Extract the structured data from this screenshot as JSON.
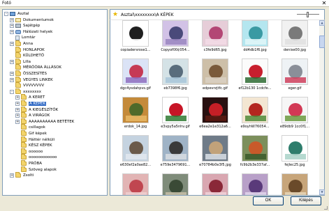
{
  "window": {
    "title": "Fotó"
  },
  "tree": [
    {
      "label": "Asztal",
      "indent": 0,
      "exp": "-",
      "icon": "desk",
      "selected": false
    },
    {
      "label": "Dokumentumok",
      "indent": 1,
      "exp": "+",
      "icon": "docs",
      "selected": false
    },
    {
      "label": "Sajátgép",
      "indent": 1,
      "exp": "+",
      "icon": "drive",
      "selected": false
    },
    {
      "label": "Hálózati helyek",
      "indent": 1,
      "exp": "+",
      "icon": "net",
      "selected": false
    },
    {
      "label": "Lomtár",
      "indent": 1,
      "exp": "",
      "icon": "bin",
      "selected": false
    },
    {
      "label": "Anna",
      "indent": 1,
      "exp": "+",
      "icon": "folder",
      "selected": false
    },
    {
      "label": "HONLAPOK",
      "indent": 1,
      "exp": "",
      "icon": "folder",
      "selected": false
    },
    {
      "label": "KÜLDHETŐ",
      "indent": 1,
      "exp": "",
      "icon": "folder",
      "selected": false
    },
    {
      "label": "Lilla",
      "indent": 1,
      "exp": "+",
      "icon": "folder",
      "selected": false
    },
    {
      "label": "MÉRŐÓRA ÁLLÁSOK",
      "indent": 1,
      "exp": "",
      "icon": "folder",
      "selected": false
    },
    {
      "label": "ÖSSZESÍTÉS",
      "indent": 1,
      "exp": "+",
      "icon": "folder",
      "selected": false
    },
    {
      "label": "VEGYES LINKEK",
      "indent": 1,
      "exp": "+",
      "icon": "folder",
      "selected": false
    },
    {
      "label": "VVVVVVVV",
      "indent": 1,
      "exp": "",
      "icon": "folder",
      "selected": false
    },
    {
      "label": "xxxxxxxx",
      "indent": 1,
      "exp": "-",
      "icon": "folder",
      "selected": false
    },
    {
      "label": "A  KERET",
      "indent": 2,
      "exp": "+",
      "icon": "folder",
      "selected": false
    },
    {
      "label": "A KÉPEK",
      "indent": 2,
      "exp": "+",
      "icon": "folder",
      "selected": true
    },
    {
      "label": "A KIEGÉSZÍTŐK",
      "indent": 2,
      "exp": "+",
      "icon": "folder",
      "selected": false
    },
    {
      "label": "A VIRÁGOK",
      "indent": 2,
      "exp": "+",
      "icon": "folder",
      "selected": false
    },
    {
      "label": "AAAAAAAAAA BETÉTEK",
      "indent": 2,
      "exp": "+",
      "icon": "folder",
      "selected": false
    },
    {
      "label": "csillagok",
      "indent": 2,
      "exp": "",
      "icon": "folder",
      "selected": false
    },
    {
      "label": "Gif képek",
      "indent": 2,
      "exp": "",
      "icon": "folder",
      "selected": false
    },
    {
      "label": "Háttér nélküli",
      "indent": 2,
      "exp": "",
      "icon": "folder",
      "selected": false
    },
    {
      "label": "KÉSZ KÉPEK",
      "indent": 2,
      "exp": "",
      "icon": "folder",
      "selected": false
    },
    {
      "label": "oooooo",
      "indent": 2,
      "exp": "",
      "icon": "folder",
      "selected": false
    },
    {
      "label": "oooooooooooo",
      "indent": 2,
      "exp": "",
      "icon": "folder",
      "selected": false
    },
    {
      "label": "PRÓBA",
      "indent": 2,
      "exp": "",
      "icon": "folder",
      "selected": false
    },
    {
      "label": "Szöveg alapok",
      "indent": 2,
      "exp": "",
      "icon": "folder",
      "selected": false
    },
    {
      "label": "Zsolti",
      "indent": 1,
      "exp": "+",
      "icon": "folder",
      "selected": false
    }
  ],
  "gallery": {
    "path": "Asztal\\xxxxxxxx\\A KÉPEK",
    "star_icon": "favorite-star-icon",
    "items": [
      {
        "caption": "copiadersrose1...",
        "c1": "#ffffff",
        "c2": "#1f1f1f",
        "c3": "#ffffff"
      },
      {
        "caption": "Copyof00¢054...",
        "c1": "#d2c2e6",
        "c2": "#4a4a7a",
        "c3": "#9a86c0"
      },
      {
        "caption": "c3fe9d65.jpg",
        "c1": "#e6cdd8",
        "c2": "#b34775",
        "c3": "#f2dbe6"
      },
      {
        "caption": "dd4db1f6.jpg",
        "c1": "#b4e6ef",
        "c2": "#3a9aa3",
        "c3": "#e2f6f8"
      },
      {
        "caption": "denise00.jpg",
        "c1": "#f1f1f1",
        "c2": "#7a7a7a",
        "c3": "#e0e0e0"
      },
      {
        "caption": "dgc4ysdahpvs.gif",
        "c1": "#dbe3f6",
        "c2": "#c63a55",
        "c3": "#8e6fc0"
      },
      {
        "caption": "eb7398f6.jpg",
        "c1": "#d4e2e6",
        "c2": "#596d7d",
        "c3": "#a8c6d8"
      },
      {
        "caption": "edpevrzjtfc.gif",
        "c1": "#cdbfa8",
        "c2": "#7a5a3b",
        "c3": "#d9d0c3"
      },
      {
        "caption": "ef12b130 1cdcfe...",
        "c1": "#fbfbfb",
        "c2": "#c81f2e",
        "c3": "#2e6b33"
      },
      {
        "caption": "eger.gif",
        "c1": "#eef2f5",
        "c2": "#8a8f99",
        "c3": "#cf3f5c"
      },
      {
        "caption": "erdok_14.jpg",
        "c1": "#c48a3a",
        "c2": "#4f6a2a",
        "c3": "#e9b966"
      },
      {
        "caption": "e3vpy5a5nhv.gif",
        "c1": "#ffffff",
        "c2": "#c71526",
        "c3": "#2f7a33"
      },
      {
        "caption": "e6ea2e1e312a6...",
        "c1": "#281010",
        "c2": "#c51f26",
        "c3": "#5a1a12"
      },
      {
        "caption": "e9oyhW76054...",
        "c1": "#f3e6d2",
        "c2": "#b3261f",
        "c3": "#4f8a3a"
      },
      {
        "caption": "e89db9 1cc0f1...",
        "c1": "#f6f6f6",
        "c2": "#d23955",
        "c3": "#6b9a3f"
      },
      {
        "caption": "e630ef2a0ae82...",
        "c1": "#c5d3e0",
        "c2": "#6b5a4a",
        "c3": "#e2e8ee"
      },
      {
        "caption": "e759e3479691...",
        "c1": "#9fb3c6",
        "c2": "#3a3a3a",
        "c3": "#d8dde2"
      },
      {
        "caption": "e70784b0e3f5.jpg",
        "c1": "#6f7b88",
        "c2": "#c1a27a",
        "c3": "#d9dfe6"
      },
      {
        "caption": "fc9b2b3e337af...",
        "c1": "#7c8f5c",
        "c2": "#c85a2a",
        "c3": "#3a5a2a"
      },
      {
        "caption": "fejlec25.jpg",
        "c1": "#ffffff",
        "c2": "#2e7d6c",
        "c3": "#a9d2c8"
      },
      {
        "caption": "",
        "c1": "#e2b4b4",
        "c2": "#c04650",
        "c3": "#f0d0d0"
      },
      {
        "caption": "",
        "c1": "#7f8c7a",
        "c2": "#3a4a36",
        "c3": "#c8c0a8"
      },
      {
        "caption": "",
        "c1": "#d9a7b1",
        "c2": "#8a2838",
        "c3": "#f1d3da"
      },
      {
        "caption": "",
        "c1": "#b8a0c8",
        "c2": "#5a3a7a",
        "c3": "#e2d6ec"
      },
      {
        "caption": "",
        "c1": "#c7a57a",
        "c2": "#6a4a2a",
        "c3": "#e8d6b8"
      }
    ]
  },
  "buttons": {
    "ok": "OK",
    "exit": "Kilépés"
  }
}
